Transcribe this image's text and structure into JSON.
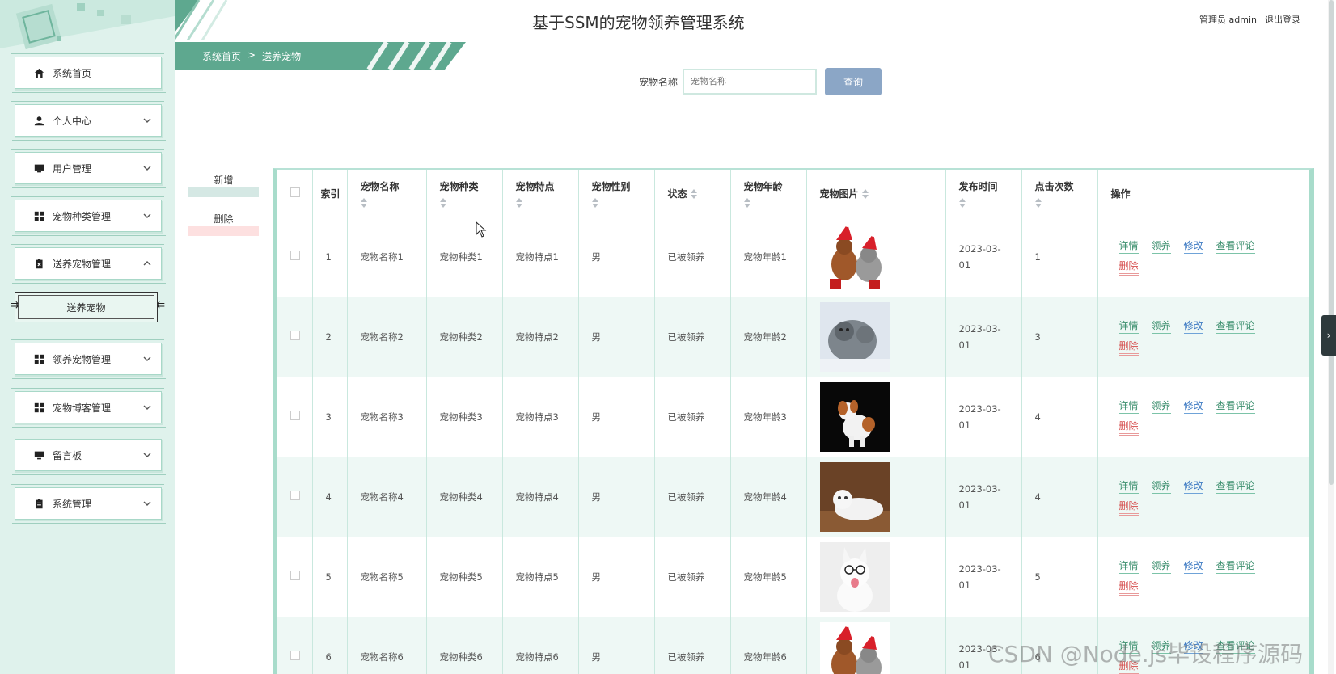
{
  "header": {
    "title": "基于SSM的宠物领养管理系统",
    "user_label": "管理员 admin",
    "logout": "退出登录"
  },
  "breadcrumb": {
    "home": "系统首页",
    "separator": ">",
    "current": "送养宠物"
  },
  "sidebar": {
    "items": [
      {
        "label": "系统首页",
        "icon": "home-icon"
      },
      {
        "label": "个人中心",
        "icon": "user-icon"
      },
      {
        "label": "用户管理",
        "icon": "monitor-icon"
      },
      {
        "label": "宠物种类管理",
        "icon": "grid-icon"
      },
      {
        "label": "送养宠物管理",
        "icon": "clipboard-x-icon"
      },
      {
        "label": "领养宠物管理",
        "icon": "grid-icon"
      },
      {
        "label": "宠物博客管理",
        "icon": "grid-icon"
      },
      {
        "label": "留言板",
        "icon": "monitor-icon"
      },
      {
        "label": "系统管理",
        "icon": "clipboard-icon"
      }
    ],
    "sub_item": "送养宠物"
  },
  "search": {
    "label": "宠物名称",
    "placeholder": "宠物名称",
    "button": "查询"
  },
  "actions": {
    "add": "新增",
    "delete": "删除"
  },
  "table": {
    "headers": {
      "index": "索引",
      "name": "宠物名称",
      "type": "宠物种类",
      "feature": "宠物特点",
      "gender": "宠物性别",
      "status": "状态",
      "age": "宠物年龄",
      "image": "宠物图片",
      "publish_time": "发布时间",
      "clicks": "点击次数",
      "ops": "操作"
    },
    "rows": [
      {
        "index": "1",
        "name": "宠物名称1",
        "type": "宠物种类1",
        "feature": "宠物特点1",
        "gender": "男",
        "status": "已被领养",
        "age": "宠物年龄1",
        "time": "2023-03-01",
        "clicks": "1"
      },
      {
        "index": "2",
        "name": "宠物名称2",
        "type": "宠物种类2",
        "feature": "宠物特点2",
        "gender": "男",
        "status": "已被领养",
        "age": "宠物年龄2",
        "time": "2023-03-01",
        "clicks": "3"
      },
      {
        "index": "3",
        "name": "宠物名称3",
        "type": "宠物种类3",
        "feature": "宠物特点3",
        "gender": "男",
        "status": "已被领养",
        "age": "宠物年龄3",
        "time": "2023-03-01",
        "clicks": "4"
      },
      {
        "index": "4",
        "name": "宠物名称4",
        "type": "宠物种类4",
        "feature": "宠物特点4",
        "gender": "男",
        "status": "已被领养",
        "age": "宠物年龄4",
        "time": "2023-03-01",
        "clicks": "4"
      },
      {
        "index": "5",
        "name": "宠物名称5",
        "type": "宠物种类5",
        "feature": "宠物特点5",
        "gender": "男",
        "status": "已被领养",
        "age": "宠物年龄5",
        "time": "2023-03-01",
        "clicks": "5"
      },
      {
        "index": "6",
        "name": "宠物名称6",
        "type": "宠物种类6",
        "feature": "宠物特点6",
        "gender": "男",
        "status": "已被领养",
        "age": "宠物年龄6",
        "time": "2023-03-01",
        "clicks": "6"
      }
    ],
    "ops": {
      "detail": "详情",
      "adopt": "领养",
      "edit": "修改",
      "comments": "查看评论",
      "delete": "删除"
    }
  },
  "watermark": "CSDN @Node.js毕设程序源码",
  "colors": {
    "accent": "#4f9a82",
    "sidebar_bg": "#dff2ec",
    "search_button": "#8ba6c6",
    "delete_red": "#d54b4b",
    "edit_blue": "#3a78c2"
  }
}
